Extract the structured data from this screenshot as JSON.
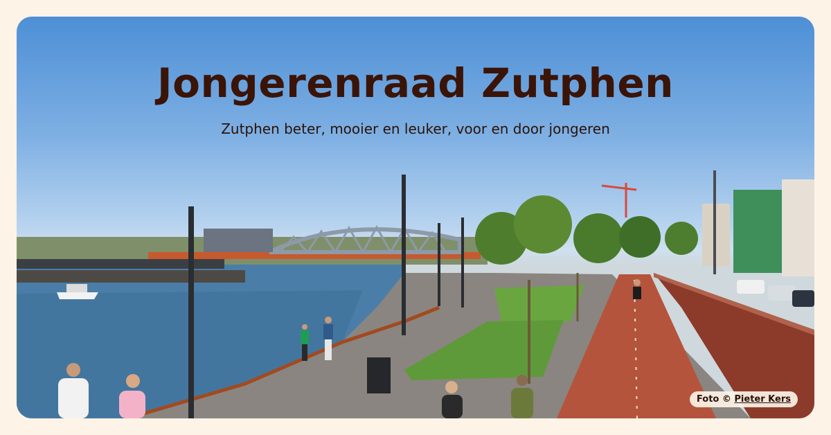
{
  "header": {
    "title": "Jongerenraad Zutphen",
    "subtitle": "Zutphen beter, mooier en leuker, voor en door jongeren"
  },
  "photo_credit": {
    "prefix": "Foto ©",
    "author": "Pieter Kers"
  },
  "colors": {
    "background": "#fdf3e7",
    "title": "#3b1408",
    "sky": "#5b98d9",
    "river": "#4a7ea8",
    "brick_path": "#b5543c",
    "grass": "#5f9a3a"
  }
}
